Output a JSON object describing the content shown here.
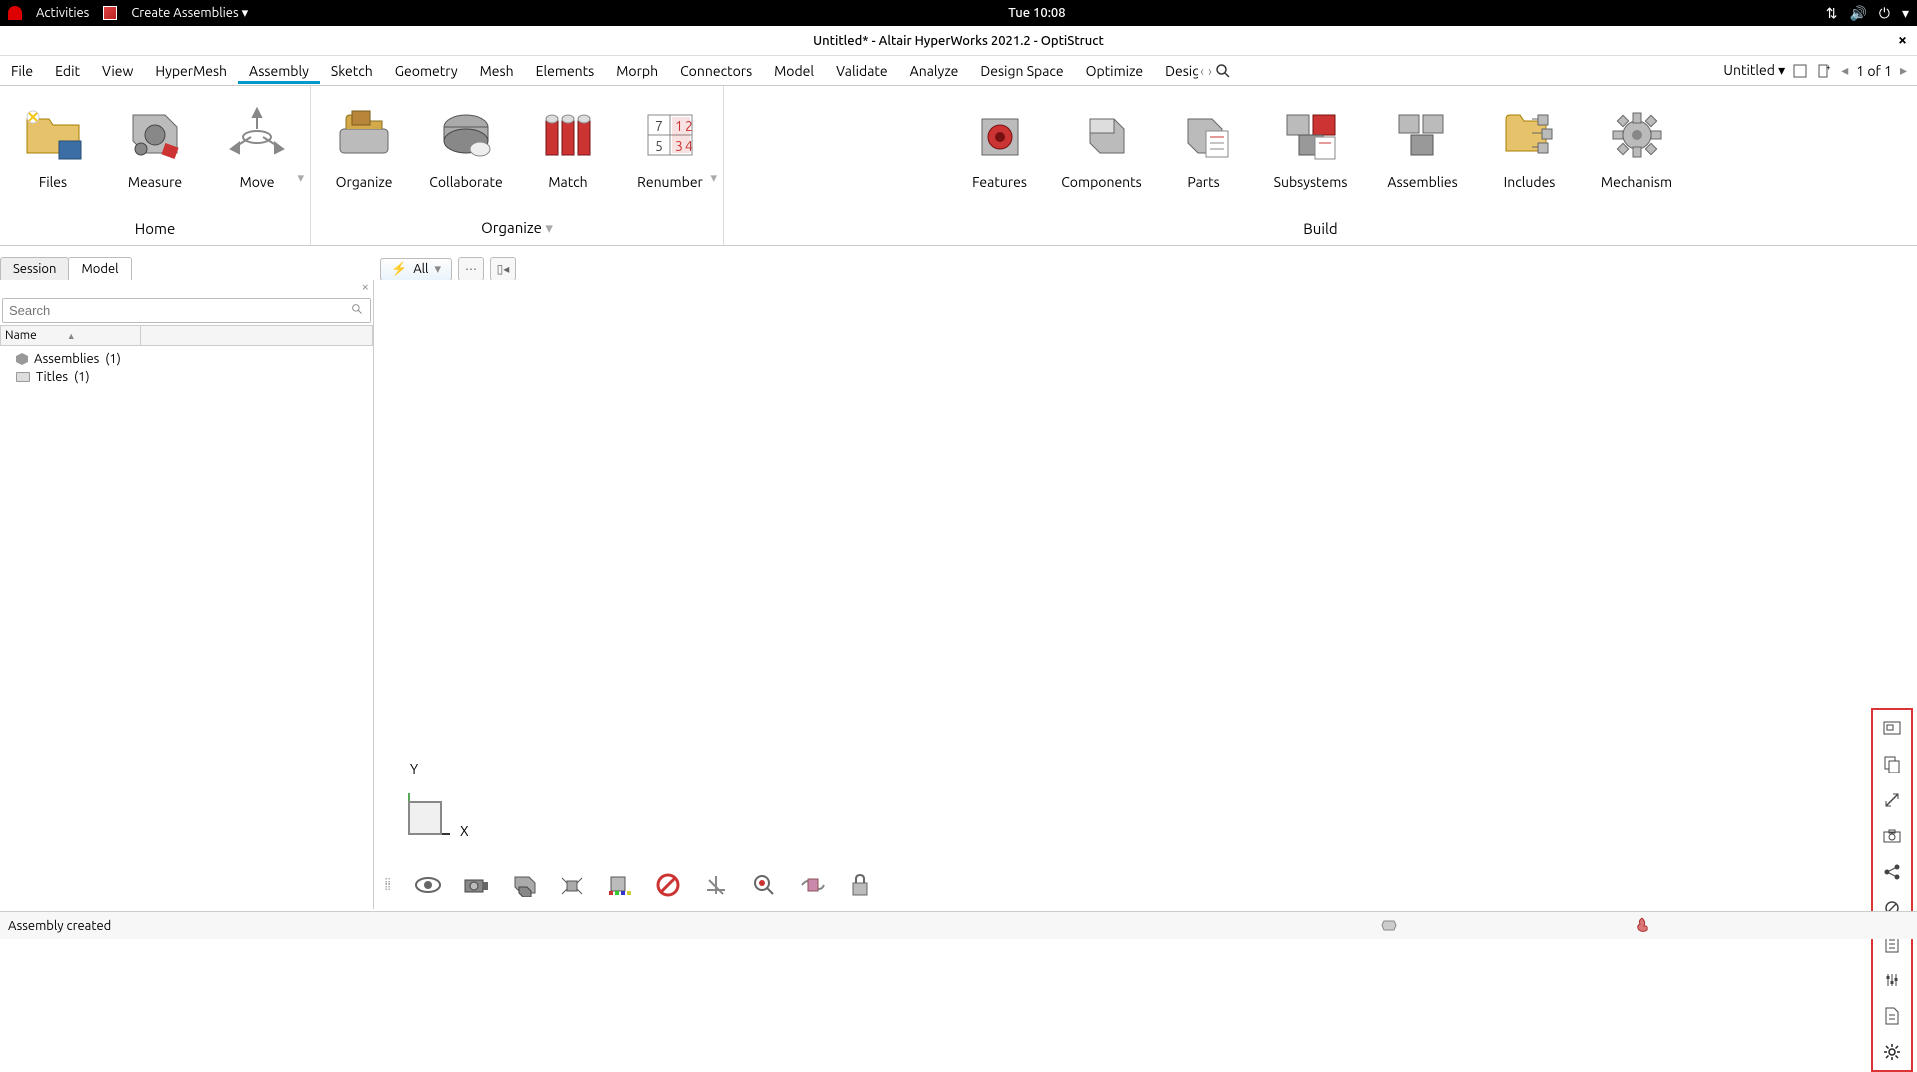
{
  "os": {
    "activities": "Activities",
    "app_menu": "Create Assemblies",
    "clock": "Tue 10:08"
  },
  "window": {
    "title": "Untitled* - Altair HyperWorks 2021.2 - OptiStruct"
  },
  "menu": {
    "items": [
      "File",
      "Edit",
      "View",
      "HyperMesh",
      "Assembly",
      "Sketch",
      "Geometry",
      "Mesh",
      "Elements",
      "Morph",
      "Connectors",
      "Model",
      "Validate",
      "Analyze",
      "Design Space",
      "Optimize",
      "Design"
    ],
    "active": "Assembly",
    "doc_name": "Untitled",
    "page_counter": "1 of 1"
  },
  "ribbon": {
    "home": {
      "label": "Home",
      "items": [
        {
          "name": "files",
          "label": "Files"
        },
        {
          "name": "measure",
          "label": "Measure"
        },
        {
          "name": "move",
          "label": "Move"
        }
      ]
    },
    "organize": {
      "label": "Organize",
      "items": [
        {
          "name": "organize",
          "label": "Organize"
        },
        {
          "name": "collaborate",
          "label": "Collaborate"
        },
        {
          "name": "match",
          "label": "Match"
        },
        {
          "name": "renumber",
          "label": "Renumber"
        }
      ]
    },
    "build": {
      "label": "Build",
      "items": [
        {
          "name": "features",
          "label": "Features"
        },
        {
          "name": "components",
          "label": "Components"
        },
        {
          "name": "parts",
          "label": "Parts"
        },
        {
          "name": "subsystems",
          "label": "Subsystems"
        },
        {
          "name": "assemblies",
          "label": "Assemblies"
        },
        {
          "name": "includes",
          "label": "Includes"
        },
        {
          "name": "mechanism",
          "label": "Mechanism"
        }
      ]
    }
  },
  "selector": {
    "all": "All"
  },
  "sub_tabs": {
    "session": "Session",
    "model": "Model"
  },
  "panel": {
    "search_placeholder": "Search",
    "col_name": "Name",
    "tree": [
      {
        "label": "Assemblies",
        "count": "(1)",
        "icon": "cube"
      },
      {
        "label": "Titles",
        "count": "(1)",
        "icon": "folder"
      }
    ]
  },
  "axis": {
    "x": "X",
    "y": "Y"
  },
  "status": {
    "message": "Assembly created"
  }
}
